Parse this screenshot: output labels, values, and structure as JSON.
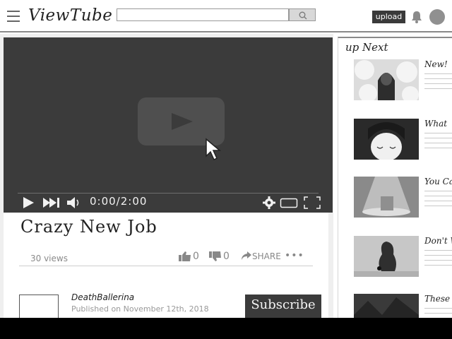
{
  "header": {
    "logo": "ViewTube",
    "search_placeholder": "",
    "upload_label": "upload"
  },
  "video": {
    "time": "0:00/2:00",
    "title": "Crazy New Job",
    "views": "30 views",
    "likes": "0",
    "dislikes": "0",
    "share_label": "SHARE",
    "more": "•••"
  },
  "channel": {
    "name": "DeathBallerina",
    "published": "Published on November 12th, 2018",
    "subscribe_label": "Subscribe"
  },
  "sidebar": {
    "heading": "up Next",
    "items": [
      {
        "title": "New!",
        "thumb": "dark-haired-figure-icon"
      },
      {
        "title": "What",
        "thumb": "sleeping-face-icon"
      },
      {
        "title": "You Ca",
        "thumb": "spotlight-object-icon"
      },
      {
        "title": "Don't W",
        "thumb": "shadow-scene-icon"
      },
      {
        "title": "These G",
        "thumb": "dark-landscape-icon"
      }
    ]
  },
  "colors": {
    "player_bg": "#3b3b3b",
    "subscribe_bg": "#3b3b3b",
    "bottom_bar": "#000000"
  }
}
